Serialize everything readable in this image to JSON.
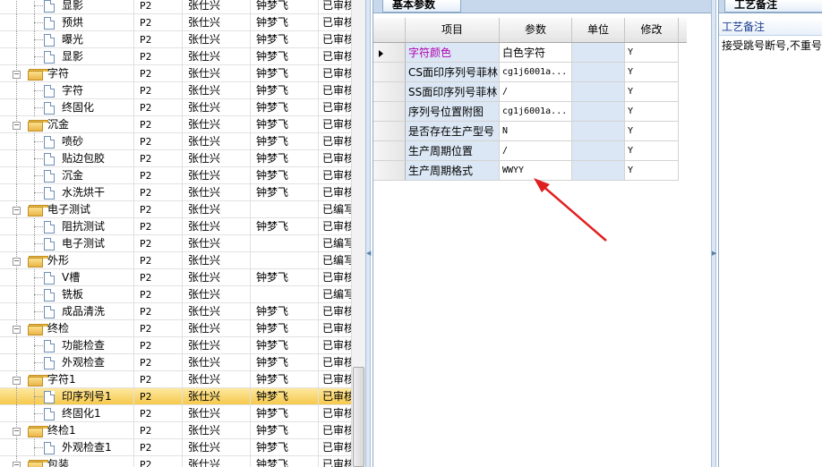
{
  "tree": {
    "rows": [
      {
        "kind": "doc",
        "name": "显影",
        "c2": "P2",
        "c3": "张仕兴",
        "c4": "钟梦飞",
        "c5": "已审核",
        "partial": true
      },
      {
        "kind": "doc",
        "name": "预烘",
        "c2": "P2",
        "c3": "张仕兴",
        "c4": "钟梦飞",
        "c5": "已审核"
      },
      {
        "kind": "doc",
        "name": "曝光",
        "c2": "P2",
        "c3": "张仕兴",
        "c4": "钟梦飞",
        "c5": "已审核"
      },
      {
        "kind": "doc",
        "name": "显影",
        "c2": "P2",
        "c3": "张仕兴",
        "c4": "钟梦飞",
        "c5": "已审核"
      },
      {
        "kind": "folder",
        "name": "字符",
        "c2": "P2",
        "c3": "张仕兴",
        "c4": "钟梦飞",
        "c5": "已审核"
      },
      {
        "kind": "doc",
        "name": "字符",
        "c2": "P2",
        "c3": "张仕兴",
        "c4": "钟梦飞",
        "c5": "已审核"
      },
      {
        "kind": "doc",
        "name": "终固化",
        "c2": "P2",
        "c3": "张仕兴",
        "c4": "钟梦飞",
        "c5": "已审核"
      },
      {
        "kind": "folder",
        "name": "沉金",
        "c2": "P2",
        "c3": "张仕兴",
        "c4": "钟梦飞",
        "c5": "已审核"
      },
      {
        "kind": "doc",
        "name": "喷砂",
        "c2": "P2",
        "c3": "张仕兴",
        "c4": "钟梦飞",
        "c5": "已审核"
      },
      {
        "kind": "doc",
        "name": "贴边包胶",
        "c2": "P2",
        "c3": "张仕兴",
        "c4": "钟梦飞",
        "c5": "已审核"
      },
      {
        "kind": "doc",
        "name": "沉金",
        "c2": "P2",
        "c3": "张仕兴",
        "c4": "钟梦飞",
        "c5": "已审核"
      },
      {
        "kind": "doc",
        "name": "水洗烘干",
        "c2": "P2",
        "c3": "张仕兴",
        "c4": "钟梦飞",
        "c5": "已审核"
      },
      {
        "kind": "folder",
        "name": "电子测试",
        "c2": "P2",
        "c3": "张仕兴",
        "c4": "",
        "c5": "已编写"
      },
      {
        "kind": "doc",
        "name": "阻抗测试",
        "c2": "P2",
        "c3": "张仕兴",
        "c4": "钟梦飞",
        "c5": "已审核"
      },
      {
        "kind": "doc",
        "name": "电子测试",
        "c2": "P2",
        "c3": "张仕兴",
        "c4": "",
        "c5": "已编写"
      },
      {
        "kind": "folder",
        "name": "外形",
        "c2": "P2",
        "c3": "张仕兴",
        "c4": "",
        "c5": "已编写"
      },
      {
        "kind": "doc",
        "name": "V槽",
        "c2": "P2",
        "c3": "张仕兴",
        "c4": "钟梦飞",
        "c5": "已审核"
      },
      {
        "kind": "doc",
        "name": "铣板",
        "c2": "P2",
        "c3": "张仕兴",
        "c4": "",
        "c5": "已编写"
      },
      {
        "kind": "doc",
        "name": "成品清洗",
        "c2": "P2",
        "c3": "张仕兴",
        "c4": "钟梦飞",
        "c5": "已审核"
      },
      {
        "kind": "folder",
        "name": "终检",
        "c2": "P2",
        "c3": "张仕兴",
        "c4": "钟梦飞",
        "c5": "已审核"
      },
      {
        "kind": "doc",
        "name": "功能检查",
        "c2": "P2",
        "c3": "张仕兴",
        "c4": "钟梦飞",
        "c5": "已审核"
      },
      {
        "kind": "doc",
        "name": "外观检查",
        "c2": "P2",
        "c3": "张仕兴",
        "c4": "钟梦飞",
        "c5": "已审核"
      },
      {
        "kind": "folder",
        "name": "字符1",
        "c2": "P2",
        "c3": "张仕兴",
        "c4": "钟梦飞",
        "c5": "已审核"
      },
      {
        "kind": "doc",
        "name": "印序列号1",
        "c2": "P2",
        "c3": "张仕兴",
        "c4": "钟梦飞",
        "c5": "已审核",
        "selected": true
      },
      {
        "kind": "doc",
        "name": "终固化1",
        "c2": "P2",
        "c3": "张仕兴",
        "c4": "钟梦飞",
        "c5": "已审核"
      },
      {
        "kind": "folder",
        "name": "终检1",
        "c2": "P2",
        "c3": "张仕兴",
        "c4": "钟梦飞",
        "c5": "已审核"
      },
      {
        "kind": "doc",
        "name": "外观检查1",
        "c2": "P2",
        "c3": "张仕兴",
        "c4": "钟梦飞",
        "c5": "已审核"
      },
      {
        "kind": "folder",
        "name": "包装",
        "c2": "P2",
        "c3": "张仕兴",
        "c4": "钟梦飞",
        "c5": "已审核"
      }
    ]
  },
  "mid": {
    "tab_label": "基本参数",
    "headers": {
      "item": "项目",
      "param": "参数",
      "unit": "单位",
      "edit": "修改"
    },
    "rows": [
      {
        "item": "字符颜色",
        "param": "白色字符",
        "unit": "",
        "edit": "Y",
        "current": true
      },
      {
        "item": "CS面印序列号菲林",
        "param": "cg1j6001a...",
        "unit": "",
        "edit": "Y"
      },
      {
        "item": "SS面印序列号菲林",
        "param": "/",
        "unit": "",
        "edit": "Y"
      },
      {
        "item": "序列号位置附图",
        "param": "cg1j6001a...",
        "unit": "",
        "edit": "Y"
      },
      {
        "item": "是否存在生产型号",
        "param": "N",
        "unit": "",
        "edit": "Y"
      },
      {
        "item": "生产周期位置",
        "param": "/",
        "unit": "",
        "edit": "Y"
      },
      {
        "item": "生产周期格式",
        "param": "WWYY",
        "unit": "",
        "edit": "Y"
      }
    ]
  },
  "right": {
    "tab_label": "工艺备注",
    "title": "工艺备注",
    "text": "接受跳号断号,不重号"
  },
  "colors": {
    "selected_row": "#f6c94d",
    "grid_accent": "#dbe7f4",
    "annotation_arrow": "#e02020",
    "selected_item_text": "#b000b0"
  }
}
